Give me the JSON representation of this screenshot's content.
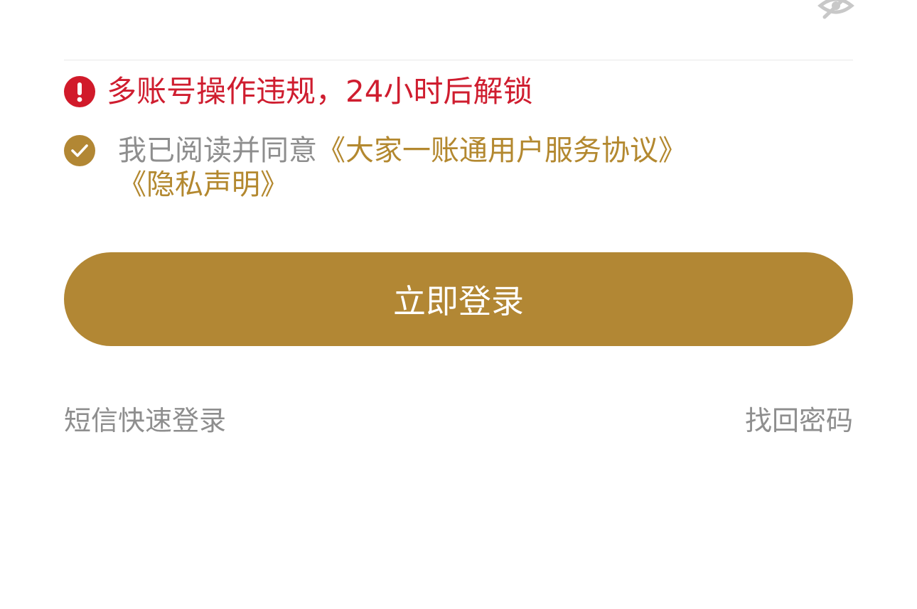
{
  "password_visibility": {
    "icon": "eye-hidden-icon"
  },
  "error": {
    "icon": "error-icon",
    "message": "多账号操作违规，24小时后解锁",
    "color": "#cf1d2f"
  },
  "agreement": {
    "checked": true,
    "prefix": "我已阅读并同意",
    "service_agreement": "《大家一账通用户服务协议》",
    "privacy_statement": "《隐私声明》",
    "link_color": "#b3882f"
  },
  "login_button": {
    "label": "立即登录",
    "color": "#b28734"
  },
  "links": {
    "sms_login": "短信快速登录",
    "forgot_password": "找回密码"
  }
}
